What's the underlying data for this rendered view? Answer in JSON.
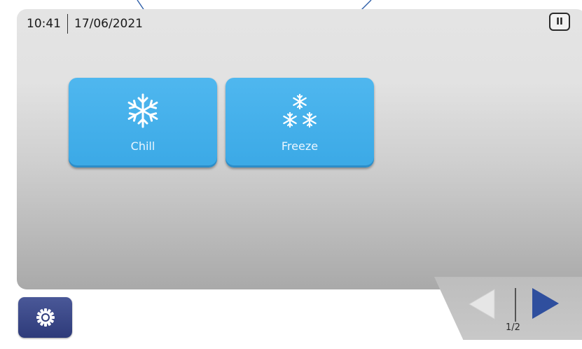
{
  "status_bar": {
    "time": "10:41",
    "date": "17/06/2021"
  },
  "tiles": [
    {
      "label": "Chill",
      "icon": "snowflake-icon"
    },
    {
      "label": "Freeze",
      "icon": "three-snowflakes-icon"
    }
  ],
  "pager": {
    "page_indicator": "1/2"
  },
  "icons": {
    "pause": "pause-icon",
    "settings": "gear-icon",
    "prev": "triangle-left-icon",
    "next": "triangle-right-icon"
  },
  "colors": {
    "tile_blue": "#3ba9e6",
    "settings_navy": "#2e3b7a",
    "next_arrow": "#2f4f9e",
    "prev_arrow_disabled": "#e4e4e4",
    "annotation_line": "#2f5fa8"
  }
}
